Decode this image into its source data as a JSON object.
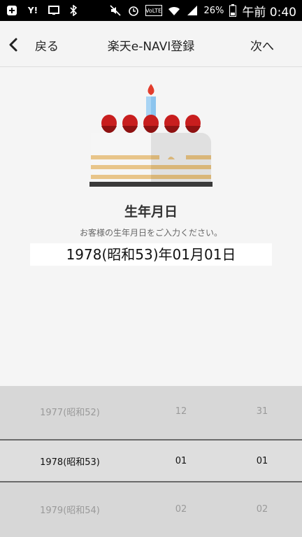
{
  "status_bar": {
    "battery_pct": "26%",
    "clock": "午前 0:40",
    "left_icons": [
      "plus-square-icon",
      "yahoo-icon",
      "screen-icon",
      "bluetooth-icon"
    ],
    "right_icons": [
      "mute-icon",
      "alarm-icon",
      "volte-icon",
      "wifi-icon",
      "signal-icon",
      "battery-icon"
    ]
  },
  "appbar": {
    "back_label": "戻る",
    "title": "楽天e-NAVI登録",
    "next_label": "次へ"
  },
  "main": {
    "section_title": "生年月日",
    "hint": "お客様の生年月日をご入力ください。",
    "date_value": "1978(昭和53)年01月01日"
  },
  "picker": {
    "rows": [
      {
        "year": "1977(昭和52)",
        "month": "12",
        "day": "31"
      },
      {
        "year": "1978(昭和53)",
        "month": "01",
        "day": "01"
      },
      {
        "year": "1979(昭和54)",
        "month": "02",
        "day": "02"
      }
    ]
  },
  "colors": {
    "strawberry": "#c81e1e",
    "cake_cream": "#f6f6f6",
    "cake_sponge": "#e8c58a",
    "candle": "#8cc4ee",
    "flame": "#e23c2c",
    "plate": "#3a3a3a",
    "picker_bg": "#d7d7d7",
    "picker_divider": "#6a6a6a"
  }
}
